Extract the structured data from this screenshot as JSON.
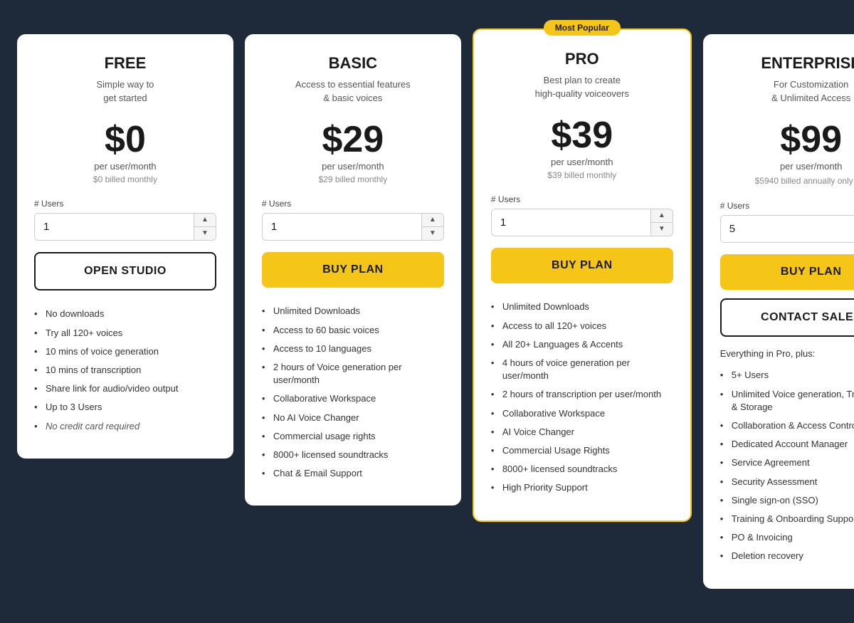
{
  "plans": [
    {
      "id": "free",
      "name": "FREE",
      "desc": "Simple way to\nget started",
      "price": "$0",
      "price_sub": "per user/month",
      "billing": "$0 billed monthly",
      "users_default": "1",
      "cta_label": "OPEN STUDIO",
      "cta_type": "outline",
      "contact_sales": false,
      "popular": false,
      "features": [
        {
          "text": "No downloads",
          "italic": false
        },
        {
          "text": "Try all 120+ voices",
          "italic": false
        },
        {
          "text": "10 mins of voice generation",
          "italic": false
        },
        {
          "text": "10 mins of transcription",
          "italic": false
        },
        {
          "text": "Share link for audio/video output",
          "italic": false
        },
        {
          "text": "Up to 3 Users",
          "italic": false
        },
        {
          "text": "No credit card required",
          "italic": true
        }
      ]
    },
    {
      "id": "basic",
      "name": "BASIC",
      "desc": "Access to essential features\n& basic voices",
      "price": "$29",
      "price_sub": "per user/month",
      "billing": "$29 billed monthly",
      "users_default": "1",
      "cta_label": "BUY PLAN",
      "cta_type": "primary",
      "contact_sales": false,
      "popular": false,
      "features": [
        {
          "text": "Unlimited Downloads",
          "italic": false
        },
        {
          "text": "Access to 60 basic voices",
          "italic": false
        },
        {
          "text": "Access to 10 languages",
          "italic": false
        },
        {
          "text": "2 hours of Voice generation per user/month",
          "italic": false
        },
        {
          "text": "Collaborative Workspace",
          "italic": false
        },
        {
          "text": "No AI Voice Changer",
          "italic": false
        },
        {
          "text": "Commercial usage rights",
          "italic": false
        },
        {
          "text": "8000+ licensed soundtracks",
          "italic": false
        },
        {
          "text": "Chat & Email Support",
          "italic": false
        }
      ]
    },
    {
      "id": "pro",
      "name": "PRO",
      "desc": "Best plan to create\nhigh-quality voiceovers",
      "price": "$39",
      "price_sub": "per user/month",
      "billing": "$39 billed monthly",
      "users_default": "1",
      "cta_label": "BUY PLAN",
      "cta_type": "primary",
      "contact_sales": false,
      "popular": true,
      "popular_label": "Most Popular",
      "features": [
        {
          "text": "Unlimited Downloads",
          "italic": false
        },
        {
          "text": "Access to all 120+ voices",
          "italic": false
        },
        {
          "text": "All 20+ Languages & Accents",
          "italic": false
        },
        {
          "text": "4 hours of voice generation per user/month",
          "italic": false
        },
        {
          "text": "2 hours of transcription per user/month",
          "italic": false
        },
        {
          "text": "Collaborative Workspace",
          "italic": false
        },
        {
          "text": "AI Voice Changer",
          "italic": false
        },
        {
          "text": "Commercial Usage Rights",
          "italic": false
        },
        {
          "text": "8000+ licensed soundtracks",
          "italic": false
        },
        {
          "text": "High Priority Support",
          "italic": false
        }
      ]
    },
    {
      "id": "enterprise",
      "name": "ENTERPRISE",
      "desc": "For Customization\n& Unlimited Access",
      "price": "$99",
      "price_sub": "per user/month",
      "billing": "$5940 billed annually only",
      "users_default": "5",
      "cta_label": "BUY PLAN",
      "cta_type": "primary",
      "contact_sales": true,
      "contact_sales_label": "CONTACT SALES",
      "popular": false,
      "enterprise_intro": "Everything in Pro, plus:",
      "features": [
        {
          "text": "5+ Users",
          "italic": false
        },
        {
          "text": "Unlimited Voice generation, Transcription & Storage",
          "italic": false
        },
        {
          "text": "Collaboration & Access Control",
          "italic": false
        },
        {
          "text": "Dedicated Account Manager",
          "italic": false
        },
        {
          "text": "Service Agreement",
          "italic": false
        },
        {
          "text": "Security Assessment",
          "italic": false
        },
        {
          "text": "Single sign-on (SSO)",
          "italic": false
        },
        {
          "text": "Training & Onboarding Support",
          "italic": false
        },
        {
          "text": "PO & Invoicing",
          "italic": false
        },
        {
          "text": "Deletion recovery",
          "italic": false
        }
      ]
    }
  ]
}
